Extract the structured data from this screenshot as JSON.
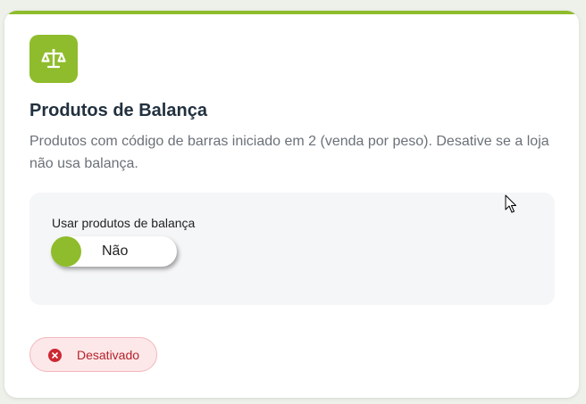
{
  "colors": {
    "accent": "#8fbc2c",
    "title": "#22313f",
    "description": "#6b7178",
    "panel_bg": "#f5f6f8",
    "status_bg": "#fde8e9",
    "status_border": "#f3b7bb",
    "status_text": "#b3232d",
    "status_icon": "#cc2833"
  },
  "card": {
    "icon": "scale-icon",
    "title": "Produtos de Balança",
    "description": "Produtos com código de barras iniciado em 2 (venda por peso). Desative se a loja não usa balança."
  },
  "setting": {
    "label": "Usar produtos de balança",
    "toggle_value": "Não"
  },
  "status": {
    "icon": "error-circle-icon",
    "label": "Desativado"
  }
}
